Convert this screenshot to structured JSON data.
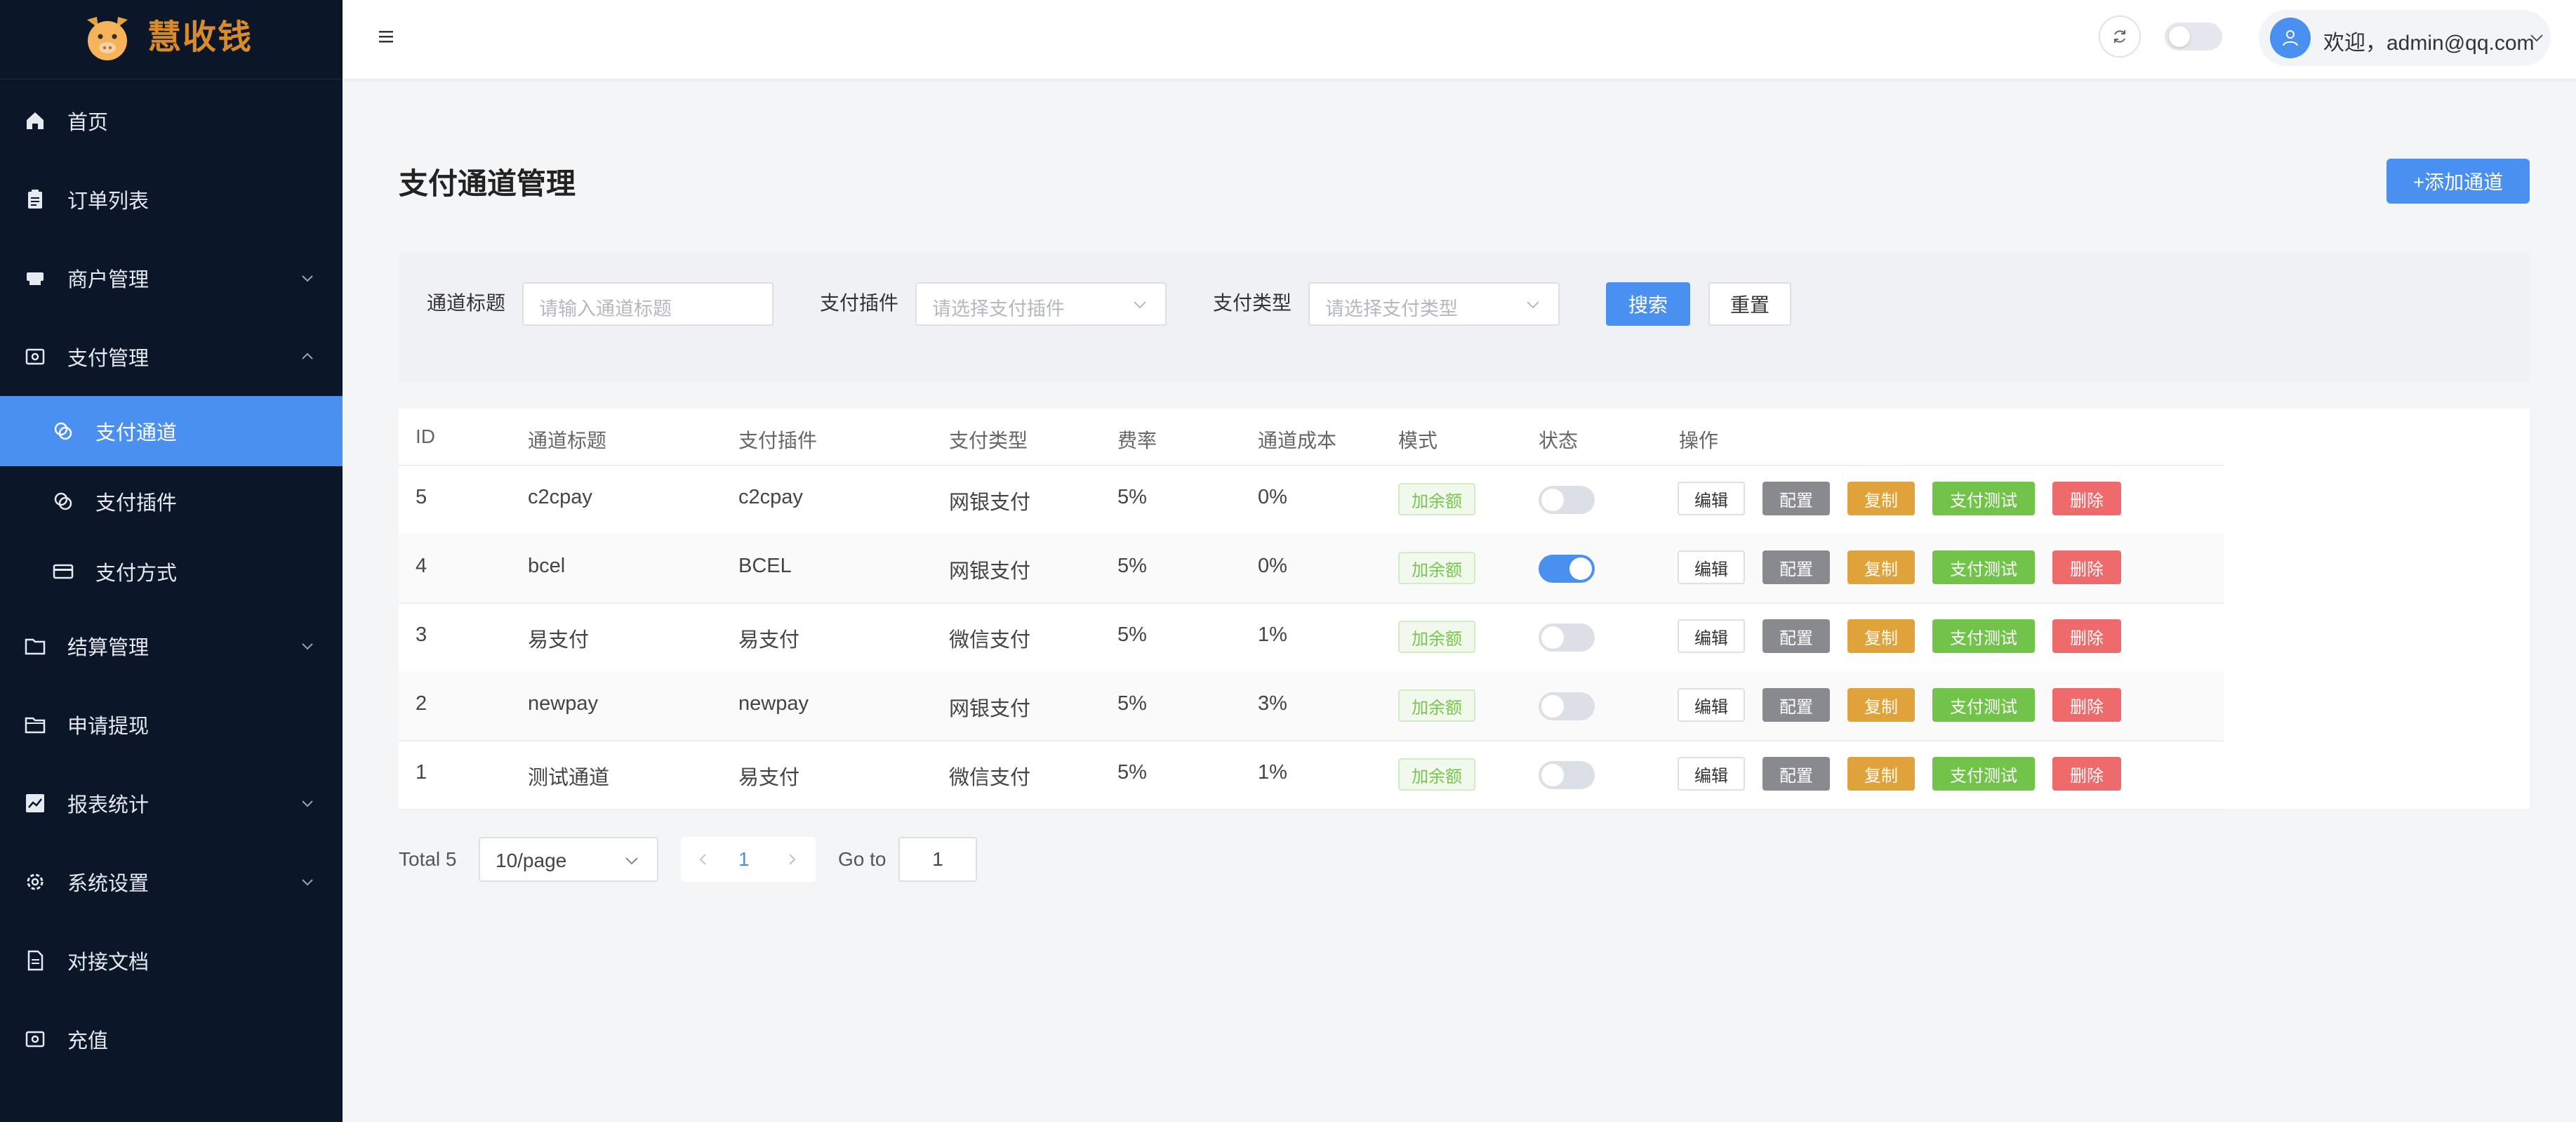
{
  "brand": {
    "name": "慧收钱"
  },
  "sidebar": {
    "items": [
      {
        "label": "首页",
        "icon": "home-icon"
      },
      {
        "label": "订单列表",
        "icon": "clipboard-icon"
      },
      {
        "label": "商户管理",
        "icon": "store-icon",
        "expandable": true
      },
      {
        "label": "支付管理",
        "icon": "payment-icon",
        "expandable": true,
        "expanded": true
      },
      {
        "label": "结算管理",
        "icon": "folder-icon",
        "expandable": true
      },
      {
        "label": "申请提现",
        "icon": "folder-outline-icon"
      },
      {
        "label": "报表统计",
        "icon": "chart-icon",
        "expandable": true
      },
      {
        "label": "系统设置",
        "icon": "gear-icon",
        "expandable": true
      },
      {
        "label": "对接文档",
        "icon": "document-icon"
      },
      {
        "label": "充值",
        "icon": "recharge-icon"
      }
    ],
    "payment_sub": [
      {
        "label": "支付通道",
        "icon": "coins-icon",
        "active": true
      },
      {
        "label": "支付插件",
        "icon": "coins-icon"
      },
      {
        "label": "支付方式",
        "icon": "card-icon"
      }
    ]
  },
  "header": {
    "user_greeting": "欢迎，admin@qq.com"
  },
  "page": {
    "title": "支付通道管理",
    "add_button": "+添加通道"
  },
  "filters": {
    "title_label": "通道标题",
    "title_placeholder": "请输入通道标题",
    "plugin_label": "支付插件",
    "plugin_placeholder": "请选择支付插件",
    "type_label": "支付类型",
    "type_placeholder": "请选择支付类型",
    "search_button": "搜索",
    "reset_button": "重置"
  },
  "table": {
    "columns": [
      "ID",
      "通道标题",
      "支付插件",
      "支付类型",
      "费率",
      "通道成本",
      "模式",
      "状态",
      "操作"
    ],
    "rows": [
      {
        "id": "5",
        "title": "c2cpay",
        "plugin": "c2cpay",
        "type": "网银支付",
        "rate": "5%",
        "cost": "0%",
        "mode": "加余额",
        "enabled": false
      },
      {
        "id": "4",
        "title": "bcel",
        "plugin": "BCEL",
        "type": "网银支付",
        "rate": "5%",
        "cost": "0%",
        "mode": "加余额",
        "enabled": true
      },
      {
        "id": "3",
        "title": "易支付",
        "plugin": "易支付",
        "type": "微信支付",
        "rate": "5%",
        "cost": "1%",
        "mode": "加余额",
        "enabled": false
      },
      {
        "id": "2",
        "title": "newpay",
        "plugin": "newpay",
        "type": "网银支付",
        "rate": "5%",
        "cost": "3%",
        "mode": "加余额",
        "enabled": false
      },
      {
        "id": "1",
        "title": "测试通道",
        "plugin": "易支付",
        "type": "微信支付",
        "rate": "5%",
        "cost": "1%",
        "mode": "加余额",
        "enabled": false
      }
    ],
    "actions": {
      "edit": "编辑",
      "config": "配置",
      "copy": "复制",
      "test": "支付测试",
      "delete": "删除"
    }
  },
  "pagination": {
    "total": "Total 5",
    "page_size": "10/page",
    "current_page": "1",
    "goto_label": "Go to",
    "goto_value": "1"
  },
  "colors": {
    "sidebar_bg": "#0b1729",
    "accent": "#4a90f0",
    "copy": "#e0a33c",
    "test": "#72c34a",
    "delete": "#ef6b6b",
    "config": "#888a8f"
  }
}
